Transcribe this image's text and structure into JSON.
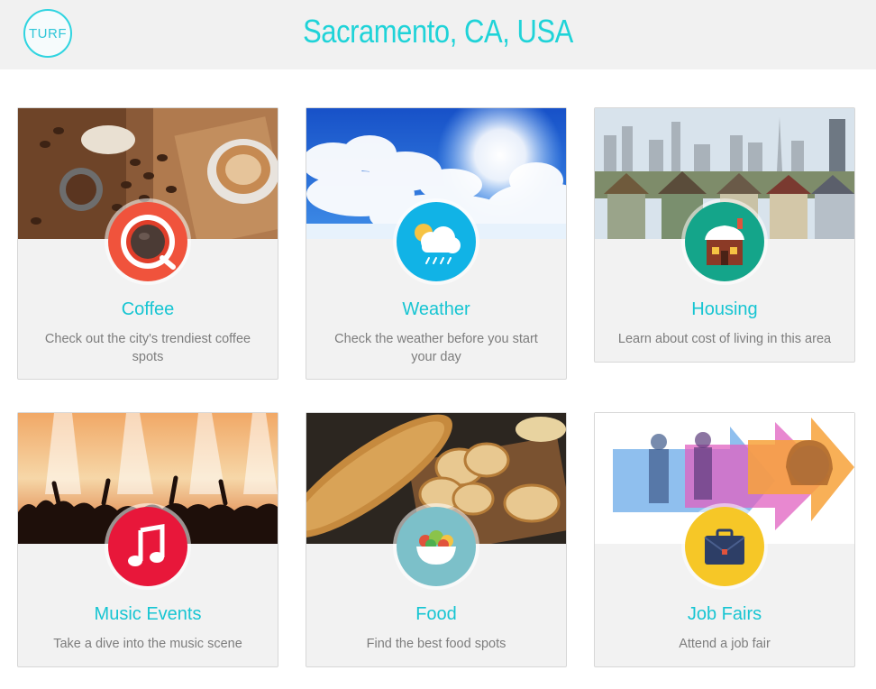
{
  "header": {
    "logo_text": "TURF",
    "city": "Sacramento, CA, USA"
  },
  "cards": [
    {
      "title": "Coffee",
      "description": "Check out the city's trendiest coffee spots",
      "icon": "coffee-cup-icon"
    },
    {
      "title": "Weather",
      "description": "Check the weather before you start your day",
      "icon": "rain-cloud-icon"
    },
    {
      "title": "Housing",
      "description": "Learn about cost of living in this area",
      "icon": "house-icon"
    },
    {
      "title": "Music Events",
      "description": "Take a dive into the music scene",
      "icon": "music-note-icon"
    },
    {
      "title": "Food",
      "description": "Find the best food spots",
      "icon": "salad-bowl-icon"
    },
    {
      "title": "Job Fairs",
      "description": "Attend a job fair",
      "icon": "briefcase-icon"
    }
  ],
  "colors": {
    "accent": "#1fd3d8",
    "header_bg": "#f1f1f1",
    "card_bg": "#f2f2f2",
    "coffee_badge": "#f0533c",
    "weather_badge": "#11b3e6",
    "housing_badge": "#14a58a",
    "music_badge": "#e8173a",
    "food_badge": "#7cc0c9",
    "jobs_badge": "#f6c727"
  }
}
